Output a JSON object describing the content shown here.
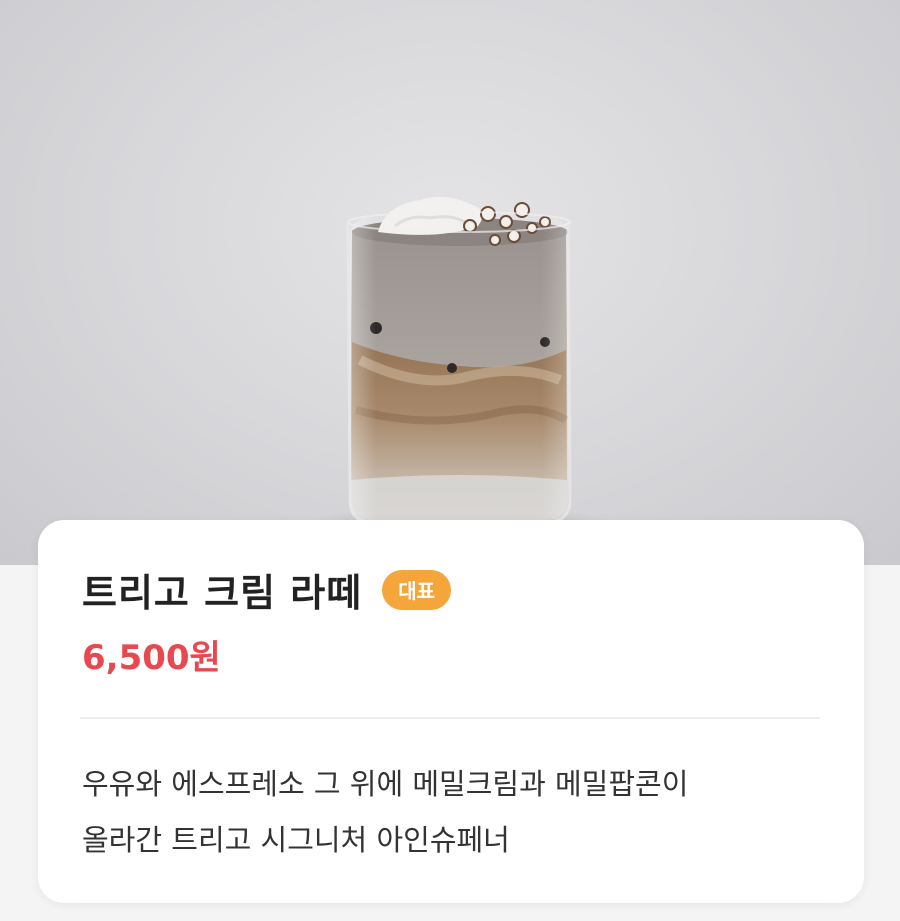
{
  "product": {
    "name": "트리고 크림 라떼",
    "badge": "대표",
    "price": "6,500원",
    "description_lines": [
      "우유와 에스프레소 그 위에 메밀크림과 메밀팝콘이",
      "올라간 트리고 시그니처 아인슈페너"
    ],
    "image_subject": "iced cream latte in glass cup"
  },
  "colors": {
    "price": "#e8484f",
    "badge_bg": "#f4a63a",
    "badge_text": "#ffffff",
    "title": "#222222",
    "description": "#333333",
    "card_bg": "#ffffff",
    "page_bg": "#f4f4f5"
  }
}
